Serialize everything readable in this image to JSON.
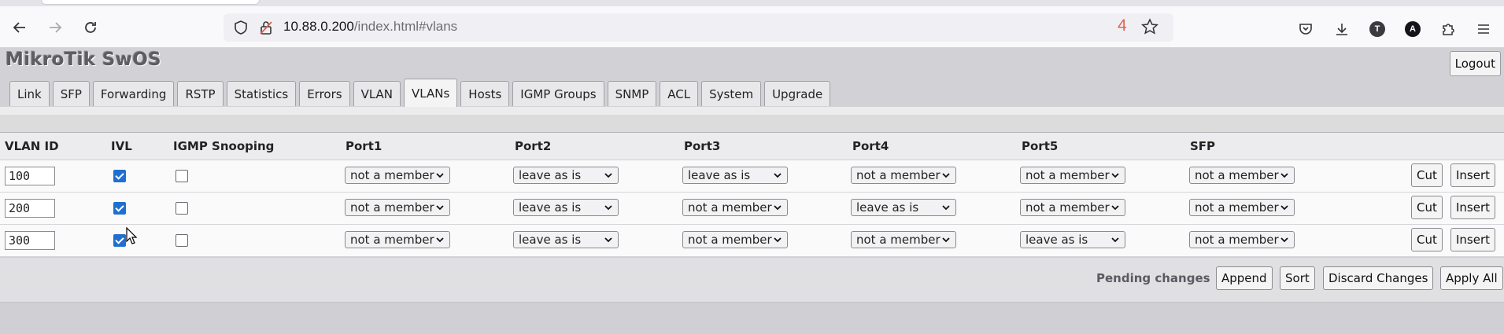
{
  "browser": {
    "url_host": "10.88.0.200",
    "url_path": "/index.html#vlans",
    "badge_count": "4",
    "account_initial": "T",
    "extension_initial": "A"
  },
  "app": {
    "title": "MikroTik SwOS",
    "logout_label": "Logout",
    "tabs": [
      {
        "label": "Link",
        "active": false
      },
      {
        "label": "SFP",
        "active": false
      },
      {
        "label": "Forwarding",
        "active": false
      },
      {
        "label": "RSTP",
        "active": false
      },
      {
        "label": "Statistics",
        "active": false
      },
      {
        "label": "Errors",
        "active": false
      },
      {
        "label": "VLAN",
        "active": false
      },
      {
        "label": "VLANs",
        "active": true
      },
      {
        "label": "Hosts",
        "active": false
      },
      {
        "label": "IGMP Groups",
        "active": false
      },
      {
        "label": "SNMP",
        "active": false
      },
      {
        "label": "ACL",
        "active": false
      },
      {
        "label": "System",
        "active": false
      },
      {
        "label": "Upgrade",
        "active": false
      }
    ]
  },
  "table": {
    "headers": [
      "VLAN ID",
      "IVL",
      "IGMP Snooping",
      "Port1",
      "Port2",
      "Port3",
      "Port4",
      "Port5",
      "SFP"
    ],
    "rows": [
      {
        "vlan_id": "100",
        "ivl": true,
        "igmp": false,
        "ports": [
          "not a member",
          "leave as is",
          "leave as is",
          "not a member",
          "not a member",
          "not a member"
        ]
      },
      {
        "vlan_id": "200",
        "ivl": true,
        "igmp": false,
        "ports": [
          "not a member",
          "leave as is",
          "not a member",
          "leave as is",
          "not a member",
          "not a member"
        ]
      },
      {
        "vlan_id": "300",
        "ivl": true,
        "igmp": false,
        "ports": [
          "not a member",
          "leave as is",
          "not a member",
          "not a member",
          "leave as is",
          "not a member"
        ]
      }
    ],
    "cut_label": "Cut",
    "insert_label": "Insert"
  },
  "footer": {
    "pending_text": "Pending changes",
    "append_label": "Append",
    "sort_label": "Sort",
    "discard_label": "Discard Changes",
    "apply_label": "Apply All"
  }
}
